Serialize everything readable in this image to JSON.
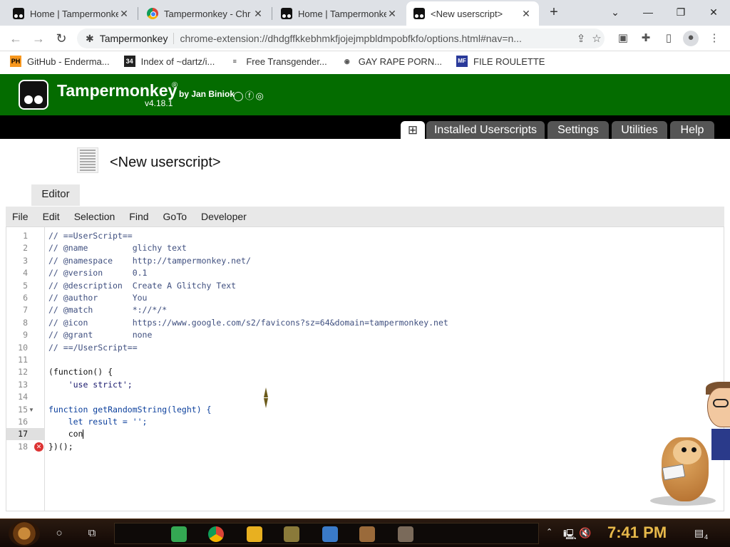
{
  "browser": {
    "tabs": [
      {
        "title": "Home | Tampermonke",
        "icon": "tampermonkey-icon",
        "active": false
      },
      {
        "title": "Tampermonkey - Chr",
        "icon": "chrome-icon",
        "active": false
      },
      {
        "title": "Home | Tampermonke",
        "icon": "tampermonkey-icon",
        "active": false
      },
      {
        "title": "<New userscript>",
        "icon": "tampermonkey-icon",
        "active": true
      }
    ],
    "new_tab": "+",
    "site_name": "Tampermonkey",
    "url": "chrome-extension://dhdgffkkebhmkfjojejmpbldmpobfkfo/options.html#nav=n...",
    "bookmarks": [
      {
        "label": "GitHub - Enderma...",
        "icon": "PH"
      },
      {
        "label": "Index of ~dartz/i...",
        "icon": "34"
      },
      {
        "label": "Free Transgender...",
        "icon": "≡"
      },
      {
        "label": "GAY RAPE PORN...",
        "icon": "◉"
      },
      {
        "label": "FILE ROULETTE",
        "icon": "MF"
      }
    ]
  },
  "tampermonkey": {
    "name": "Tampermonkey",
    "reg": "®",
    "author": "by Jan Biniok",
    "version": "v4.18.1",
    "social": "◯ⓕ◎",
    "nav": {
      "add": "⊞",
      "installed": "Installed Userscripts",
      "settings": "Settings",
      "utilities": "Utilities",
      "help": "Help"
    },
    "script_title": "<New userscript>",
    "editor_tab": "Editor",
    "menu": [
      "File",
      "Edit",
      "Selection",
      "Find",
      "GoTo",
      "Developer"
    ]
  },
  "editor": {
    "current_line": 17,
    "error_line": 18,
    "fold_line": 15,
    "lines": [
      "// ==UserScript==",
      "// @name         glichy text",
      "// @namespace    http://tampermonkey.net/",
      "// @version      0.1",
      "// @description  Create A Glitchy Text",
      "// @author       You",
      "// @match        *://*/*",
      "// @icon         https://www.google.com/s2/favicons?sz=64&domain=tampermonkey.net",
      "// @grant        none",
      "// ==/UserScript==",
      "",
      "(function() {",
      "    'use strict';",
      "",
      "function getRandomString(leght) {",
      "    let result = '';",
      "    con",
      "})();"
    ]
  },
  "taskbar": {
    "clock": "7:41 PM",
    "notifications": "4"
  },
  "colors": {
    "tm_green": "#046c00",
    "nav_black": "#000000",
    "clock_gold": "#e6b84a"
  }
}
